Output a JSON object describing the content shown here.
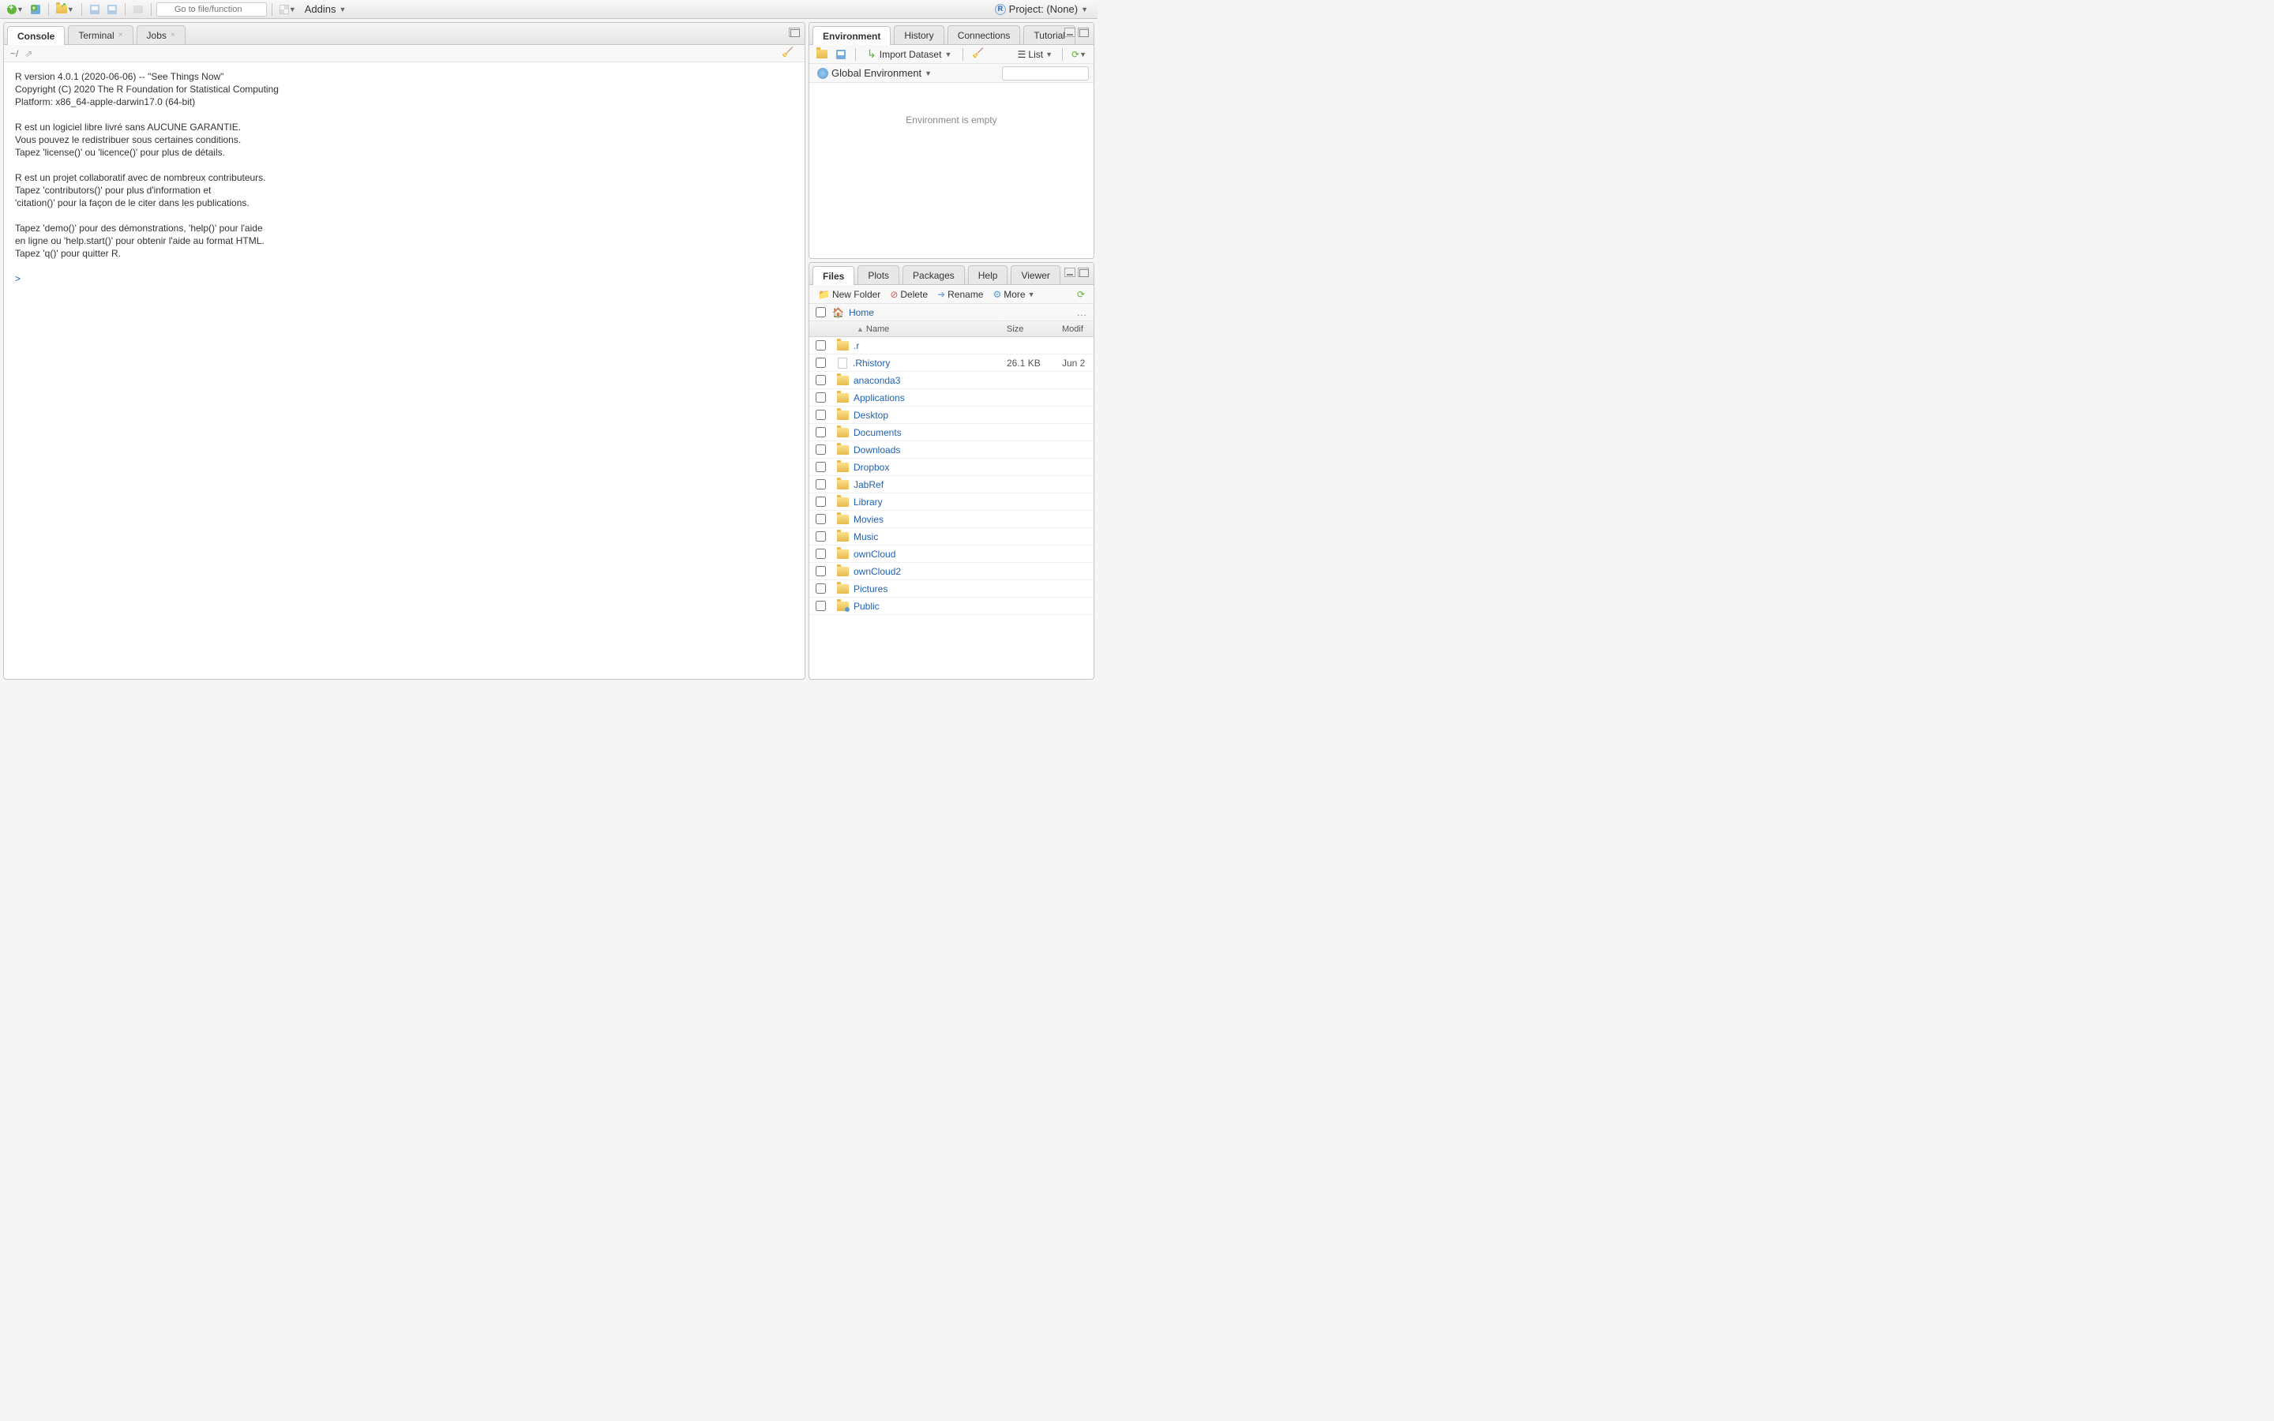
{
  "toolbar": {
    "goto_placeholder": "Go to file/function",
    "addins_label": "Addins"
  },
  "project": {
    "label": "Project: (None)"
  },
  "left": {
    "tabs": [
      "Console",
      "Terminal",
      "Jobs"
    ],
    "path": "~/",
    "console_text": "R version 4.0.1 (2020-06-06) -- \"See Things Now\"\nCopyright (C) 2020 The R Foundation for Statistical Computing\nPlatform: x86_64-apple-darwin17.0 (64-bit)\n\nR est un logiciel libre livré sans AUCUNE GARANTIE.\nVous pouvez le redistribuer sous certaines conditions.\nTapez 'license()' ou 'licence()' pour plus de détails.\n\nR est un projet collaboratif avec de nombreux contributeurs.\nTapez 'contributors()' pour plus d'information et\n'citation()' pour la façon de le citer dans les publications.\n\nTapez 'demo()' pour des démonstrations, 'help()' pour l'aide\nen ligne ou 'help.start()' pour obtenir l'aide au format HTML.\nTapez 'q()' pour quitter R.\n",
    "prompt": ">"
  },
  "env": {
    "tabs": [
      "Environment",
      "History",
      "Connections",
      "Tutorial"
    ],
    "import_label": "Import Dataset",
    "list_label": "List",
    "scope_label": "Global Environment",
    "empty_text": "Environment is empty"
  },
  "files": {
    "tabs": [
      "Files",
      "Plots",
      "Packages",
      "Help",
      "Viewer"
    ],
    "new_folder": "New Folder",
    "delete": "Delete",
    "rename": "Rename",
    "more": "More",
    "home": "Home",
    "col_name": "Name",
    "col_size": "Size",
    "col_mod": "Modif",
    "rows": [
      {
        "name": ".r",
        "type": "folder",
        "size": "",
        "mod": ""
      },
      {
        "name": ".Rhistory",
        "type": "file",
        "size": "26.1 KB",
        "mod": "Jun 2"
      },
      {
        "name": "anaconda3",
        "type": "folder",
        "size": "",
        "mod": ""
      },
      {
        "name": "Applications",
        "type": "folder",
        "size": "",
        "mod": ""
      },
      {
        "name": "Desktop",
        "type": "folder",
        "size": "",
        "mod": ""
      },
      {
        "name": "Documents",
        "type": "folder",
        "size": "",
        "mod": ""
      },
      {
        "name": "Downloads",
        "type": "folder",
        "size": "",
        "mod": ""
      },
      {
        "name": "Dropbox",
        "type": "folder",
        "size": "",
        "mod": ""
      },
      {
        "name": "JabRef",
        "type": "folder",
        "size": "",
        "mod": ""
      },
      {
        "name": "Library",
        "type": "folder",
        "size": "",
        "mod": ""
      },
      {
        "name": "Movies",
        "type": "folder",
        "size": "",
        "mod": ""
      },
      {
        "name": "Music",
        "type": "folder",
        "size": "",
        "mod": ""
      },
      {
        "name": "ownCloud",
        "type": "folder",
        "size": "",
        "mod": ""
      },
      {
        "name": "ownCloud2",
        "type": "folder",
        "size": "",
        "mod": ""
      },
      {
        "name": "Pictures",
        "type": "folder",
        "size": "",
        "mod": ""
      },
      {
        "name": "Public",
        "type": "folder-public",
        "size": "",
        "mod": ""
      }
    ]
  }
}
